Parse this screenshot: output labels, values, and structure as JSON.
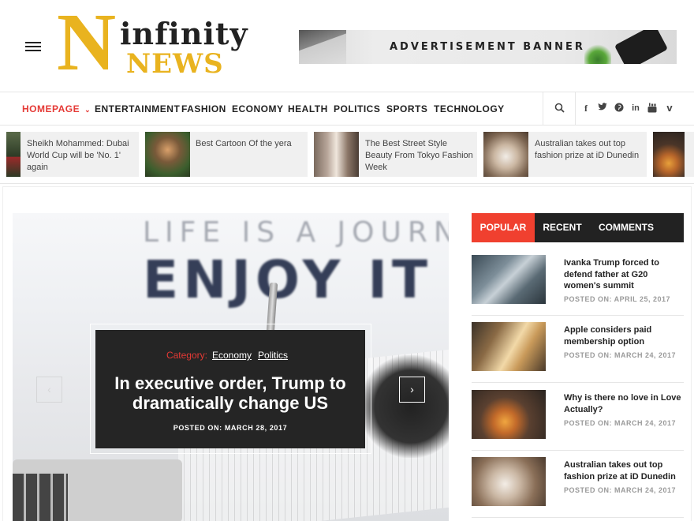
{
  "header": {
    "logo_n": "N",
    "logo_line1": "infinity",
    "logo_line2": "NEWS",
    "ad_text": "ADVERTISEMENT BANNER"
  },
  "nav": {
    "items": [
      "HOMEPAGE",
      "ENTERTAINMENT",
      "FASHION",
      "ECONOMY",
      "HEALTH",
      "POLITICS",
      "SPORTS",
      "TECHNOLOGY"
    ],
    "active": "HOMEPAGE",
    "chevron": "⌄",
    "search_icon": "⌕",
    "social": {
      "facebook": "f",
      "twitter": "t",
      "pinterest": "p",
      "linkedin": "in",
      "youtube": "▶",
      "vimeo": "v"
    }
  },
  "ticker": [
    {
      "text": "Sheikh Mohammed: Dubai World Cup will be 'No. 1' again"
    },
    {
      "text": "Best Cartoon Of the yera"
    },
    {
      "text": "The Best Street Style Beauty From Tokyo Fashion Week"
    },
    {
      "text": "Australian takes out top fashion prize at iD Dunedin"
    }
  ],
  "hero": {
    "bg_line1": "LIFE IS A JOURNEY",
    "bg_line2": "ENJOY IT",
    "category_label": "Category:",
    "categories": [
      "Economy",
      "Politics"
    ],
    "title": "In executive order, Trump to dramatically change US",
    "date": "POSTED ON: MARCH 28, 2017",
    "prev": "‹",
    "next": "›"
  },
  "sidebar": {
    "tabs": [
      "POPULAR",
      "RECENT",
      "COMMENTS"
    ],
    "active_tab": "POPULAR",
    "posts": [
      {
        "title": "Ivanka Trump forced to defend father at G20 women's summit",
        "date": "POSTED ON: APRIL 25, 2017"
      },
      {
        "title": "Apple considers paid membership option",
        "date": "POSTED ON: MARCH 24, 2017"
      },
      {
        "title": "Why is there no love in Love Actually?",
        "date": "POSTED ON: MARCH 24, 2017"
      },
      {
        "title": "Australian takes out top fashion prize at iD Dunedin",
        "date": "POSTED ON: MARCH 24, 2017"
      }
    ]
  },
  "colors": {
    "accent_red": "#f0402f",
    "logo_gold": "#e9b31f",
    "dark": "#222222"
  }
}
